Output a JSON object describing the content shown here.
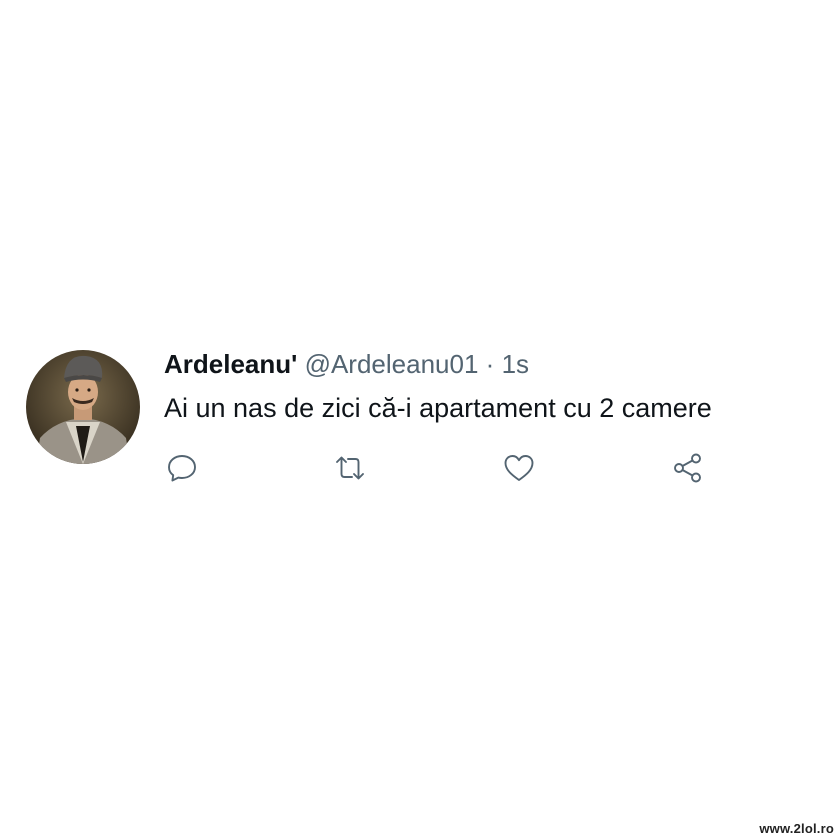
{
  "tweet": {
    "author": {
      "display_name": "Ardeleanu'",
      "handle": "@Ardeleanu01",
      "avatar": "portrait-avatar"
    },
    "separator": "·",
    "timestamp": "1s",
    "text": "Ai un nas de zici că-i apartament cu 2 camere",
    "actions": [
      {
        "name": "reply",
        "icon": "speech-bubble-icon"
      },
      {
        "name": "retweet",
        "icon": "retweet-arrows-icon"
      },
      {
        "name": "like",
        "icon": "heart-icon"
      },
      {
        "name": "share",
        "icon": "share-nodes-icon"
      }
    ]
  },
  "watermark": "www.2lol.ro",
  "colors": {
    "text_primary": "#0f1419",
    "text_secondary": "#536471",
    "background": "#ffffff"
  }
}
